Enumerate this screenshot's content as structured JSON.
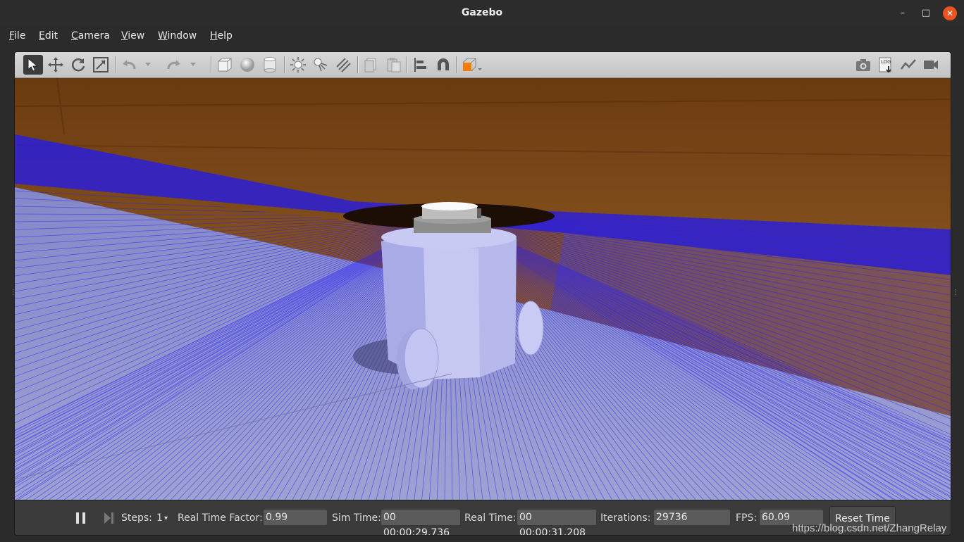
{
  "window": {
    "title": "Gazebo"
  },
  "menu": [
    {
      "label": "File",
      "mn": "F",
      "rest": "ile"
    },
    {
      "label": "Edit",
      "mn": "E",
      "rest": "dit"
    },
    {
      "label": "Camera",
      "mn": "C",
      "rest": "amera"
    },
    {
      "label": "View",
      "mn": "V",
      "rest": "iew"
    },
    {
      "label": "Window",
      "mn": "W",
      "rest": "indow"
    },
    {
      "label": "Help",
      "mn": "H",
      "rest": "elp"
    }
  ],
  "toolbar": {
    "left_icons": [
      "select-arrow-icon",
      "translate-icon",
      "rotate-icon",
      "scale-icon",
      "undo-icon",
      "undo-dropdown-icon",
      "redo-icon",
      "redo-dropdown-icon",
      "box-shape-icon",
      "sphere-shape-icon",
      "cylinder-shape-icon",
      "point-light-icon",
      "spot-light-icon",
      "directional-light-icon",
      "copy-icon",
      "paste-icon",
      "align-icon",
      "snap-magnet-icon",
      "view-angle-icon"
    ],
    "right_icons": [
      "screenshot-camera-icon",
      "log-icon",
      "plot-icon",
      "video-record-icon"
    ],
    "log_text": "LOG"
  },
  "status": {
    "steps_label": "Steps:",
    "steps_value": "1",
    "rtf_label": "Real Time Factor:",
    "rtf_value": "0.99",
    "sim_time_label": "Sim Time:",
    "sim_time_value": "00 00:00:29.736",
    "real_time_label": "Real Time:",
    "real_time_value": "00 00:00:31.208",
    "iterations_label": "Iterations:",
    "iterations_value": "29736",
    "fps_label": "FPS:",
    "fps_value": "60.09",
    "reset_label": "Reset Time"
  },
  "watermark": "https://blog.csdn.net/ZhangRelay",
  "colors": {
    "accent_close": "#e95420",
    "laser_blue": "#2a1fff",
    "floor": "#9a9fcf",
    "wall": "#7a4a1c",
    "robot": "#b9bbee"
  }
}
